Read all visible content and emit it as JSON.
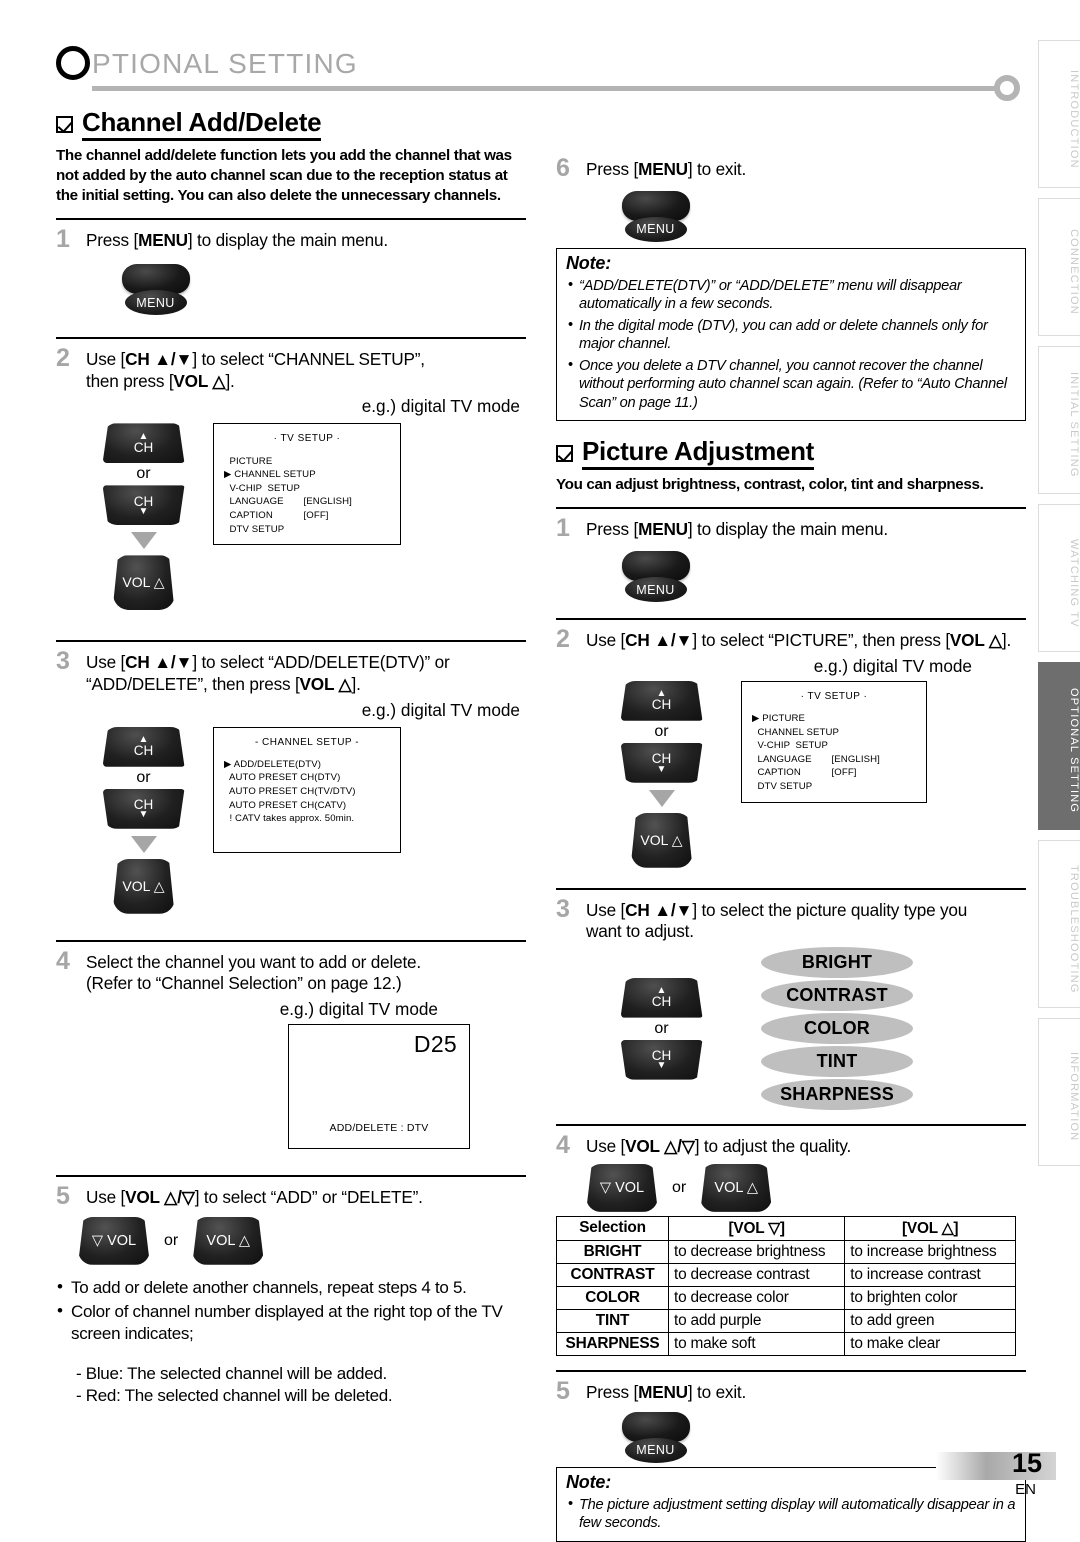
{
  "header": {
    "title_first": "O",
    "title_rest": "PTIONAL  SETTING"
  },
  "tabs": [
    {
      "label": "INTRODUCTION",
      "active": false
    },
    {
      "label": "CONNECTION",
      "active": false
    },
    {
      "label": "INITIAL  SETTING",
      "active": false
    },
    {
      "label": "WATCHING  TV",
      "active": false
    },
    {
      "label": "OPTIONAL  SETTING",
      "active": true
    },
    {
      "label": "TROUBLESHOOTING",
      "active": false
    },
    {
      "label": "INFORMATION",
      "active": false
    }
  ],
  "page": {
    "number": "15",
    "lang": "EN"
  },
  "section1": {
    "title": "Channel Add/Delete",
    "desc": "The channel add/delete function lets you add the channel that was not added by the auto channel scan due to the reception status at the initial setting. You can also delete the unnecessary channels.",
    "step1": {
      "num": "1",
      "text_pre": "Press [",
      "text_bold": "MENU",
      "text_post": "] to display the main menu.",
      "button": "MENU"
    },
    "step2": {
      "num": "2",
      "line1_pre": "Use [",
      "line1_bold": "CH ▲/▼",
      "line1_post": "] to select “CHANNEL SETUP”,",
      "line2_pre": "then press [",
      "line2_bold": "VOL △",
      "line2_post": "].",
      "eg": "e.g.) digital TV mode",
      "menu": {
        "title": "·  TV SETUP  ·",
        "rows": [
          {
            "marker": "  ",
            "label": "PICTURE",
            "value": ""
          },
          {
            "marker": "▶ ",
            "label": "CHANNEL SETUP",
            "value": ""
          },
          {
            "marker": "  ",
            "label": "V-CHIP  SETUP",
            "value": ""
          },
          {
            "marker": "  ",
            "label": "LANGUAGE",
            "value": "[ENGLISH]"
          },
          {
            "marker": "  ",
            "label": "CAPTION",
            "value": "[OFF]"
          },
          {
            "marker": "  ",
            "label": "DTV SETUP",
            "value": ""
          }
        ]
      }
    },
    "step3": {
      "num": "3",
      "line1_pre": "Use [",
      "line1_bold": "CH ▲/▼",
      "line1_post": "] to select “ADD/DELETE(DTV)” or",
      "line2_pre": "“ADD/DELETE”, then press [",
      "line2_bold": "VOL △",
      "line2_post": "].",
      "eg": "e.g.) digital TV mode",
      "menu": {
        "title": "- CHANNEL SETUP -",
        "rows": [
          {
            "marker": "▶ ",
            "label": "ADD/DELETE(DTV)",
            "value": ""
          },
          {
            "marker": "  ",
            "label": "AUTO PRESET CH(DTV)",
            "value": ""
          },
          {
            "marker": "  ",
            "label": "AUTO PRESET CH(TV/DTV)",
            "value": ""
          },
          {
            "marker": "  ",
            "label": "AUTO PRESET CH(CATV)",
            "value": ""
          },
          {
            "marker": "  ",
            "label": "! CATV takes approx. 50min.",
            "value": ""
          }
        ]
      }
    },
    "step4": {
      "num": "4",
      "line1": "Select the channel you want to add or delete.",
      "line2": "(Refer to “Channel Selection” on page 12.)",
      "eg": "e.g.) digital TV mode",
      "screen_number": "D25",
      "screen_footer": "ADD/DELETE : DTV"
    },
    "step5": {
      "num": "5",
      "text_pre": "Use [",
      "text_bold": "VOL △/▽",
      "text_post": "] to select “ADD” or “DELETE”.",
      "btn_down": "▽ VOL",
      "btn_or": "or",
      "btn_up": "VOL △"
    },
    "bullets": [
      "To add or delete another channels, repeat steps 4 to 5.",
      "Color of channel number displayed at the right top of the TV screen indicates;"
    ],
    "dashes": [
      "- Blue: The selected channel will be added.",
      "- Red: The selected channel will be deleted."
    ]
  },
  "section1_right": {
    "step6": {
      "num": "6",
      "text_pre": "Press [",
      "text_bold": "MENU",
      "text_post": "] to exit.",
      "button": "MENU"
    },
    "note": {
      "title": "Note:",
      "items": [
        "“ADD/DELETE(DTV)” or “ADD/DELETE” menu will disappear automatically in a few seconds.",
        "In the digital mode (DTV), you can add or delete channels only for major channel.",
        "Once you delete a DTV channel, you cannot recover the channel without performing auto channel scan again. (Refer to “Auto Channel Scan” on page 11.)"
      ]
    }
  },
  "section2": {
    "title": "Picture Adjustment",
    "desc": "You can adjust brightness, contrast, color, tint and sharpness.",
    "step1": {
      "num": "1",
      "text_pre": "Press [",
      "text_bold": "MENU",
      "text_post": "] to display the main menu.",
      "button": "MENU"
    },
    "step2": {
      "num": "2",
      "text_pre": "Use [",
      "text_bold1": "CH ▲/▼",
      "text_mid": "] to select “PICTURE”, then press [",
      "text_bold2": "VOL △",
      "text_post": "].",
      "eg": "e.g.) digital TV mode",
      "menu": {
        "title": "·  TV SETUP  ·",
        "rows": [
          {
            "marker": "▶ ",
            "label": "PICTURE",
            "value": ""
          },
          {
            "marker": "  ",
            "label": "CHANNEL SETUP",
            "value": ""
          },
          {
            "marker": "  ",
            "label": "V-CHIP  SETUP",
            "value": ""
          },
          {
            "marker": "  ",
            "label": "LANGUAGE",
            "value": "[ENGLISH]"
          },
          {
            "marker": "  ",
            "label": "CAPTION",
            "value": "[OFF]"
          },
          {
            "marker": "  ",
            "label": "DTV SETUP",
            "value": ""
          }
        ]
      }
    },
    "step3": {
      "num": "3",
      "line1_pre": "Use [",
      "line1_bold": "CH ▲/▼",
      "line1_post": "] to select the picture quality type you",
      "line2": "want to adjust.",
      "pills": [
        "BRIGHT",
        "CONTRAST",
        "COLOR",
        "TINT",
        "SHARPNESS"
      ]
    },
    "step4": {
      "num": "4",
      "text_pre": "Use [",
      "text_bold": "VOL △/▽",
      "text_post": "] to adjust the quality.",
      "btn_down": "▽ VOL",
      "btn_or": "or",
      "btn_up": "VOL △",
      "table": {
        "headers": [
          "Selection",
          "[VOL ▽]",
          "[VOL △]"
        ],
        "rows": [
          [
            "BRIGHT",
            "to decrease brightness",
            "to increase brightness"
          ],
          [
            "CONTRAST",
            "to decrease contrast",
            "to increase contrast"
          ],
          [
            "COLOR",
            "to decrease color",
            "to brighten color"
          ],
          [
            "TINT",
            "to add purple",
            "to add green"
          ],
          [
            "SHARPNESS",
            "to make soft",
            "to make clear"
          ]
        ]
      }
    },
    "step5": {
      "num": "5",
      "text_pre": "Press [",
      "text_bold": "MENU",
      "text_post": "] to exit.",
      "button": "MENU"
    },
    "note": {
      "title": "Note:",
      "items": [
        "The picture adjustment setting display will automatically disappear in a few seconds."
      ]
    }
  }
}
